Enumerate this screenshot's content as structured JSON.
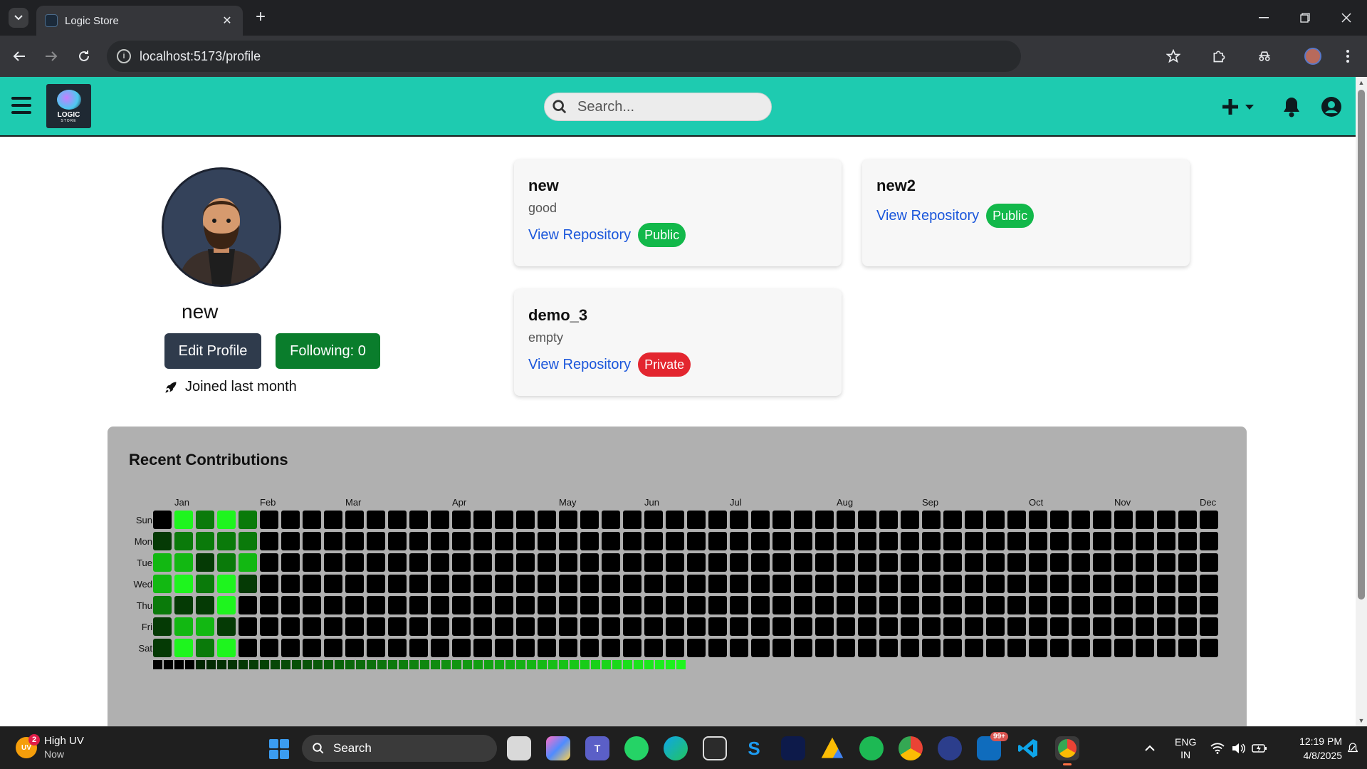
{
  "browser": {
    "tab_title": "Logic Store",
    "url": "localhost:5173/profile"
  },
  "app": {
    "logo_text": "LOGIC",
    "logo_subtext": "STORE",
    "search_placeholder": "Search..."
  },
  "profile": {
    "username": "new",
    "edit_label": "Edit Profile",
    "following_label": "Following: 0",
    "joined_text": "Joined last month"
  },
  "repos": [
    {
      "name": "new",
      "description": "good",
      "link": "View Repository",
      "visibility": "Public"
    },
    {
      "name": "new2",
      "description": "",
      "link": "View Repository",
      "visibility": "Public"
    },
    {
      "name": "demo_3",
      "description": "empty",
      "link": "View Repository",
      "visibility": "Private"
    }
  ],
  "contributions": {
    "title": "Recent Contributions",
    "months": [
      "Jan",
      "Feb",
      "Mar",
      "Apr",
      "May",
      "Jun",
      "Jul",
      "Aug",
      "Sep",
      "Oct",
      "Nov",
      "Dec"
    ],
    "days": [
      "Sun",
      "Mon",
      "Tue",
      "Wed",
      "Thu",
      "Fri",
      "Sat"
    ],
    "weeks": 50,
    "active_levels": [
      [
        0,
        4,
        2,
        4,
        2
      ],
      [
        1,
        2,
        2,
        2,
        2
      ],
      [
        3,
        3,
        1,
        2,
        3
      ],
      [
        3,
        4,
        2,
        4,
        1
      ],
      [
        2,
        1,
        1,
        4,
        0
      ],
      [
        1,
        3,
        3,
        1,
        0
      ],
      [
        1,
        4,
        2,
        4,
        0
      ]
    ],
    "colors": {
      "0": "#000000",
      "1": "#053a05",
      "2": "#0a7a0a",
      "3": "#12b812",
      "4": "#1ef51e"
    }
  },
  "taskbar": {
    "weather_title": "High UV",
    "weather_sub": "Now",
    "weather_badge": "2",
    "weather_icon_text": "UV",
    "search_label": "Search",
    "notif_badge": "99+",
    "lang_top": "ENG",
    "lang_bottom": "IN",
    "time": "12:19 PM",
    "date": "4/8/2025"
  }
}
